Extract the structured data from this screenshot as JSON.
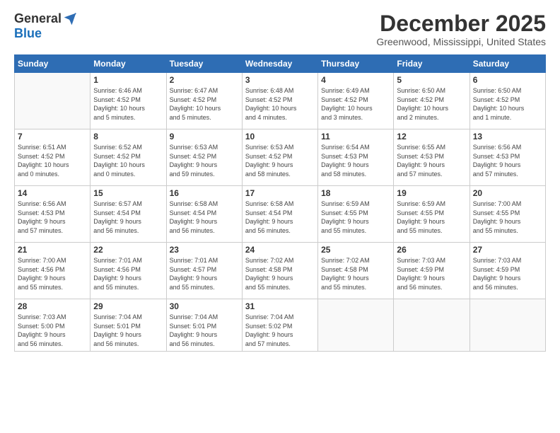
{
  "logo": {
    "general": "General",
    "blue": "Blue"
  },
  "title": "December 2025",
  "location": "Greenwood, Mississippi, United States",
  "days_header": [
    "Sunday",
    "Monday",
    "Tuesday",
    "Wednesday",
    "Thursday",
    "Friday",
    "Saturday"
  ],
  "weeks": [
    [
      {
        "day": "",
        "info": ""
      },
      {
        "day": "1",
        "info": "Sunrise: 6:46 AM\nSunset: 4:52 PM\nDaylight: 10 hours\nand 5 minutes."
      },
      {
        "day": "2",
        "info": "Sunrise: 6:47 AM\nSunset: 4:52 PM\nDaylight: 10 hours\nand 5 minutes."
      },
      {
        "day": "3",
        "info": "Sunrise: 6:48 AM\nSunset: 4:52 PM\nDaylight: 10 hours\nand 4 minutes."
      },
      {
        "day": "4",
        "info": "Sunrise: 6:49 AM\nSunset: 4:52 PM\nDaylight: 10 hours\nand 3 minutes."
      },
      {
        "day": "5",
        "info": "Sunrise: 6:50 AM\nSunset: 4:52 PM\nDaylight: 10 hours\nand 2 minutes."
      },
      {
        "day": "6",
        "info": "Sunrise: 6:50 AM\nSunset: 4:52 PM\nDaylight: 10 hours\nand 1 minute."
      }
    ],
    [
      {
        "day": "7",
        "info": "Sunrise: 6:51 AM\nSunset: 4:52 PM\nDaylight: 10 hours\nand 0 minutes."
      },
      {
        "day": "8",
        "info": "Sunrise: 6:52 AM\nSunset: 4:52 PM\nDaylight: 10 hours\nand 0 minutes."
      },
      {
        "day": "9",
        "info": "Sunrise: 6:53 AM\nSunset: 4:52 PM\nDaylight: 9 hours\nand 59 minutes."
      },
      {
        "day": "10",
        "info": "Sunrise: 6:53 AM\nSunset: 4:52 PM\nDaylight: 9 hours\nand 58 minutes."
      },
      {
        "day": "11",
        "info": "Sunrise: 6:54 AM\nSunset: 4:53 PM\nDaylight: 9 hours\nand 58 minutes."
      },
      {
        "day": "12",
        "info": "Sunrise: 6:55 AM\nSunset: 4:53 PM\nDaylight: 9 hours\nand 57 minutes."
      },
      {
        "day": "13",
        "info": "Sunrise: 6:56 AM\nSunset: 4:53 PM\nDaylight: 9 hours\nand 57 minutes."
      }
    ],
    [
      {
        "day": "14",
        "info": "Sunrise: 6:56 AM\nSunset: 4:53 PM\nDaylight: 9 hours\nand 57 minutes."
      },
      {
        "day": "15",
        "info": "Sunrise: 6:57 AM\nSunset: 4:54 PM\nDaylight: 9 hours\nand 56 minutes."
      },
      {
        "day": "16",
        "info": "Sunrise: 6:58 AM\nSunset: 4:54 PM\nDaylight: 9 hours\nand 56 minutes."
      },
      {
        "day": "17",
        "info": "Sunrise: 6:58 AM\nSunset: 4:54 PM\nDaylight: 9 hours\nand 56 minutes."
      },
      {
        "day": "18",
        "info": "Sunrise: 6:59 AM\nSunset: 4:55 PM\nDaylight: 9 hours\nand 55 minutes."
      },
      {
        "day": "19",
        "info": "Sunrise: 6:59 AM\nSunset: 4:55 PM\nDaylight: 9 hours\nand 55 minutes."
      },
      {
        "day": "20",
        "info": "Sunrise: 7:00 AM\nSunset: 4:55 PM\nDaylight: 9 hours\nand 55 minutes."
      }
    ],
    [
      {
        "day": "21",
        "info": "Sunrise: 7:00 AM\nSunset: 4:56 PM\nDaylight: 9 hours\nand 55 minutes."
      },
      {
        "day": "22",
        "info": "Sunrise: 7:01 AM\nSunset: 4:56 PM\nDaylight: 9 hours\nand 55 minutes."
      },
      {
        "day": "23",
        "info": "Sunrise: 7:01 AM\nSunset: 4:57 PM\nDaylight: 9 hours\nand 55 minutes."
      },
      {
        "day": "24",
        "info": "Sunrise: 7:02 AM\nSunset: 4:58 PM\nDaylight: 9 hours\nand 55 minutes."
      },
      {
        "day": "25",
        "info": "Sunrise: 7:02 AM\nSunset: 4:58 PM\nDaylight: 9 hours\nand 55 minutes."
      },
      {
        "day": "26",
        "info": "Sunrise: 7:03 AM\nSunset: 4:59 PM\nDaylight: 9 hours\nand 56 minutes."
      },
      {
        "day": "27",
        "info": "Sunrise: 7:03 AM\nSunset: 4:59 PM\nDaylight: 9 hours\nand 56 minutes."
      }
    ],
    [
      {
        "day": "28",
        "info": "Sunrise: 7:03 AM\nSunset: 5:00 PM\nDaylight: 9 hours\nand 56 minutes."
      },
      {
        "day": "29",
        "info": "Sunrise: 7:04 AM\nSunset: 5:01 PM\nDaylight: 9 hours\nand 56 minutes."
      },
      {
        "day": "30",
        "info": "Sunrise: 7:04 AM\nSunset: 5:01 PM\nDaylight: 9 hours\nand 56 minutes."
      },
      {
        "day": "31",
        "info": "Sunrise: 7:04 AM\nSunset: 5:02 PM\nDaylight: 9 hours\nand 57 minutes."
      },
      {
        "day": "",
        "info": ""
      },
      {
        "day": "",
        "info": ""
      },
      {
        "day": "",
        "info": ""
      }
    ]
  ]
}
